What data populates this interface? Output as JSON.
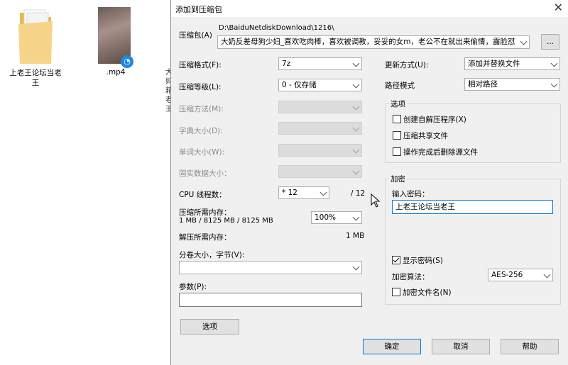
{
  "desktop": {
    "folder_label": "上老王论坛当老王",
    "video_label": ".mp4",
    "strip_chars": [
      "大",
      "妈",
      "藉",
      "老",
      "王"
    ]
  },
  "dialog": {
    "title": "添加到压缩包",
    "archive": {
      "label": "压缩包(A)",
      "path": "D:\\BaiduNetdiskDownload\\1216\\",
      "name": "大奶反差母狗少妇_喜欢吃肉棒，喜欢被调教，妥妥的女m，老公不在就出来偷情，露脸怼",
      "browse_label": "..."
    },
    "format": {
      "label": "压缩格式(F):",
      "value": "7z"
    },
    "level": {
      "label": "压缩等级(L):",
      "value": "0 - 仅存储"
    },
    "method": {
      "label": "压缩方法(M):"
    },
    "dict_size": {
      "label": "字典大小(D):"
    },
    "word_size": {
      "label": "单词大小(W):"
    },
    "solid_size": {
      "label": "固实数据大小："
    },
    "cpu": {
      "label": "CPU 线程数：",
      "value": "* 12",
      "max": "/ 12"
    },
    "mem_compress": {
      "label": "压缩所需内存：",
      "detail": "1 MB / 8125 MB / 8125 MB",
      "percent": "100%"
    },
    "mem_decompress": {
      "label": "解压所需内存：",
      "value": "1 MB"
    },
    "volume": {
      "label": "分卷大小，字节(V):",
      "value": ""
    },
    "params": {
      "label": "参数(P):",
      "value": ""
    },
    "options_button": "选项",
    "update_mode": {
      "label": "更新方式(U):",
      "value": "添加并替换文件"
    },
    "path_mode": {
      "label": "路径模式",
      "value": "相对路径"
    },
    "options_group": {
      "title": "选项",
      "sfx": {
        "label": "创建自解压程序(X)",
        "checked": false
      },
      "shared": {
        "label": "压缩共享文件",
        "checked": false
      },
      "delete_after": {
        "label": "操作完成后删除源文件",
        "checked": false
      }
    },
    "encryption": {
      "title": "加密",
      "password_label": "输入密码：",
      "password": "上老王论坛当老王",
      "show_password": {
        "label": "显示密码(S)",
        "checked": true
      },
      "method_label": "加密算法：",
      "method": "AES-256",
      "encrypt_names": {
        "label": "加密文件名(N)",
        "checked": false
      }
    },
    "buttons": {
      "ok": "确定",
      "cancel": "取消",
      "help": "帮助"
    }
  }
}
